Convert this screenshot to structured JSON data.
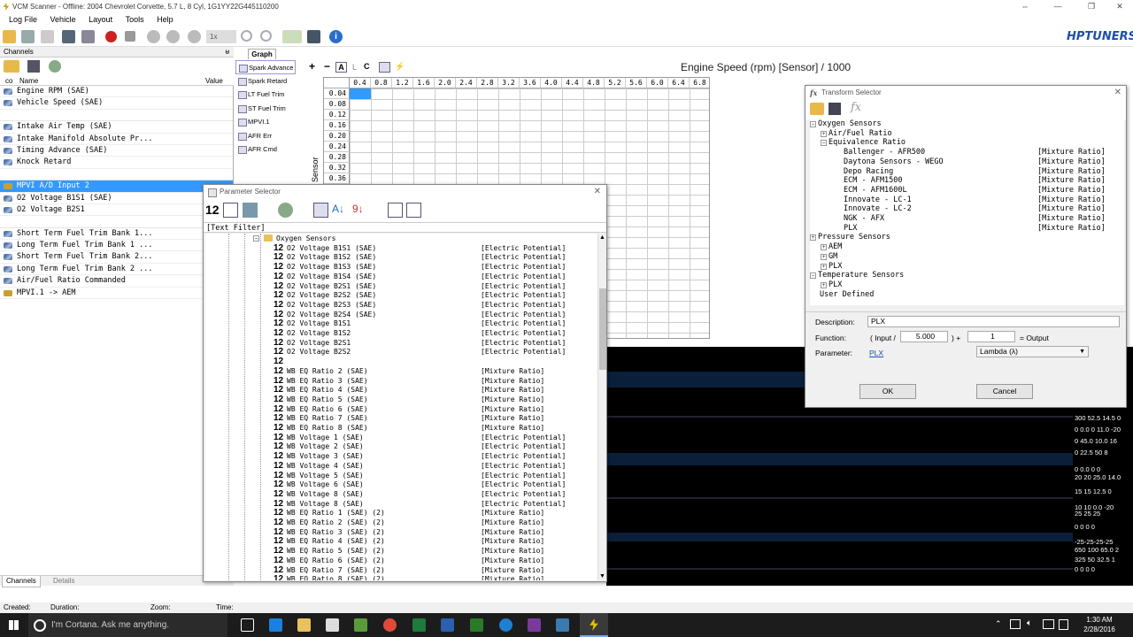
{
  "titlebar": {
    "title": "VCM Scanner - Offline: 2004 Chevrolet Corvette, 5.7 L, 8 Cyl, 1G1YY22G445110200"
  },
  "menu": [
    "Log File",
    "Vehicle",
    "Layout",
    "Tools",
    "Help"
  ],
  "toolbar": {
    "speed_value": "1x"
  },
  "logo": {
    "text": "HPTUNERS"
  },
  "channels": {
    "header": "Channels",
    "pin": "ᵾ",
    "col_co": "co",
    "col_name": "Name",
    "col_value": "Value",
    "rows": [
      {
        "name": "Engine RPM (SAE)",
        "icon": "gauge-icon"
      },
      {
        "name": "Vehicle Speed (SAE)",
        "icon": "gauge-icon"
      },
      {
        "name": "",
        "icon": ""
      },
      {
        "name": "Intake Air Temp (SAE)",
        "icon": "gauge-icon"
      },
      {
        "name": "Intake Manifold Absolute Pr...",
        "icon": "gauge-icon"
      },
      {
        "name": "Timing Advance (SAE)",
        "icon": "gauge-icon"
      },
      {
        "name": "Knock Retard",
        "icon": "gauge-icon"
      },
      {
        "name": "",
        "icon": ""
      },
      {
        "name": "MPVI A/D Input 2",
        "icon": "analog-icon"
      },
      {
        "name": "O2 Voltage B1S1 (SAE)",
        "icon": "gauge-icon"
      },
      {
        "name": "O2 Voltage B2S1",
        "icon": "gauge-icon"
      },
      {
        "name": "",
        "icon": ""
      },
      {
        "name": "Short Term Fuel Trim Bank 1...",
        "icon": "gauge-icon"
      },
      {
        "name": "Long Term Fuel Trim Bank 1 ...",
        "icon": "gauge-icon"
      },
      {
        "name": "Short Term Fuel Trim Bank 2...",
        "icon": "gauge-icon"
      },
      {
        "name": "Long Term Fuel Trim Bank 2 ...",
        "icon": "gauge-icon"
      },
      {
        "name": "Air/Fuel Ratio Commanded",
        "icon": "gauge-icon"
      },
      {
        "name": "MPVI.1 -> AEM",
        "icon": "analog-icon"
      }
    ],
    "tab_channels": "Channels",
    "tab_details": "Details"
  },
  "graph": {
    "tab": "Graph",
    "side_items": [
      "Spark Advance",
      "Spark Retard",
      "LT Fuel Trim",
      "ST Fuel Trim",
      "MPVI.1",
      "AFR Err",
      "AFR Cmd"
    ],
    "tool_labels": [
      "+",
      "−",
      "A",
      "L",
      "C"
    ],
    "title": "Engine Speed (rpm) [Sensor] / 1000",
    "y_axis_label": "Sensor",
    "col_headers": [
      "0.4",
      "0.8",
      "1.2",
      "1.6",
      "2.0",
      "2.4",
      "2.8",
      "3.2",
      "3.6",
      "4.0",
      "4.4",
      "4.8",
      "5.2",
      "5.6",
      "6.0",
      "6.4",
      "6.8"
    ],
    "row_headers": [
      "0.04",
      "0.08",
      "0.12",
      "0.16",
      "0.20",
      "0.24",
      "0.28",
      "0.32",
      "0.36"
    ]
  },
  "scope_values": [
    "300 52.5  14.5  0",
    "0  0.0   0  11.0 -20",
    "0 45.0  10.0 16",
    "0  22.5  50  8",
    "0  0.0  0  0",
    "20 20 25.0 14.0",
    "15  15  12.5 0",
    "10 10 0.0 -20",
    "25 25 25",
    "0  0  0  0",
    "-25-25-25-25",
    "650  100 65.0 2",
    "325  50  32.5 1",
    "0  0  0  0"
  ],
  "param_selector": {
    "title": "Parameter Selector",
    "filter": "[Text Filter]",
    "group": "Oxygen Sensors",
    "rows": [
      {
        "name": "O2 Voltage B1S1 (SAE)",
        "unit": "[Electric Potential]"
      },
      {
        "name": "O2 Voltage B1S2 (SAE)",
        "unit": "[Electric Potential]"
      },
      {
        "name": "O2 Voltage B1S3 (SAE)",
        "unit": "[Electric Potential]"
      },
      {
        "name": "O2 Voltage B1S4 (SAE)",
        "unit": "[Electric Potential]"
      },
      {
        "name": "O2 Voltage B2S1 (SAE)",
        "unit": "[Electric Potential]"
      },
      {
        "name": "O2 Voltage B2S2 (SAE)",
        "unit": "[Electric Potential]"
      },
      {
        "name": "O2 Voltage B2S3 (SAE)",
        "unit": "[Electric Potential]"
      },
      {
        "name": "O2 Voltage B2S4 (SAE)",
        "unit": "[Electric Potential]"
      },
      {
        "name": "O2 Voltage B1S1",
        "unit": "[Electric Potential]"
      },
      {
        "name": "O2 Voltage B1S2",
        "unit": "[Electric Potential]"
      },
      {
        "name": "O2 Voltage B2S1",
        "unit": "[Electric Potential]"
      },
      {
        "name": "O2 Voltage B2S2",
        "unit": "[Electric Potential]"
      },
      {
        "name": "",
        "unit": ""
      },
      {
        "name": "WB EQ Ratio 2 (SAE)",
        "unit": "[Mixture Ratio]"
      },
      {
        "name": "WB EQ Ratio 3 (SAE)",
        "unit": "[Mixture Ratio]"
      },
      {
        "name": "WB EQ Ratio 4 (SAE)",
        "unit": "[Mixture Ratio]"
      },
      {
        "name": "WB EQ Ratio 5 (SAE)",
        "unit": "[Mixture Ratio]"
      },
      {
        "name": "WB EQ Ratio 6 (SAE)",
        "unit": "[Mixture Ratio]"
      },
      {
        "name": "WB EQ Ratio 7 (SAE)",
        "unit": "[Mixture Ratio]"
      },
      {
        "name": "WB EQ Ratio 8 (SAE)",
        "unit": "[Mixture Ratio]"
      },
      {
        "name": "WB Voltage 1 (SAE)",
        "unit": "[Electric Potential]"
      },
      {
        "name": "WB Voltage 2 (SAE)",
        "unit": "[Electric Potential]"
      },
      {
        "name": "WB Voltage 3 (SAE)",
        "unit": "[Electric Potential]"
      },
      {
        "name": "WB Voltage 4 (SAE)",
        "unit": "[Electric Potential]"
      },
      {
        "name": "WB Voltage 5 (SAE)",
        "unit": "[Electric Potential]"
      },
      {
        "name": "WB Voltage 6 (SAE)",
        "unit": "[Electric Potential]"
      },
      {
        "name": "WB Voltage 8 (SAE)",
        "unit": "[Electric Potential]"
      },
      {
        "name": "WB Voltage 8 (SAE)",
        "unit": "[Electric Potential]"
      },
      {
        "name": "WB EQ Ratio 1 (SAE) (2)",
        "unit": "[Mixture Ratio]"
      },
      {
        "name": "WB EQ Ratio 2 (SAE) (2)",
        "unit": "[Mixture Ratio]"
      },
      {
        "name": "WB EQ Ratio 3 (SAE) (2)",
        "unit": "[Mixture Ratio]"
      },
      {
        "name": "WB EQ Ratio 4 (SAE) (2)",
        "unit": "[Mixture Ratio]"
      },
      {
        "name": "WB EQ Ratio 5 (SAE) (2)",
        "unit": "[Mixture Ratio]"
      },
      {
        "name": "WB EQ Ratio 6 (SAE) (2)",
        "unit": "[Mixture Ratio]"
      },
      {
        "name": "WB EQ Ratio 7 (SAE) (2)",
        "unit": "[Mixture Ratio]"
      },
      {
        "name": "WB EQ Ratio 8 (SAE) (2)",
        "unit": "[Mixture Ratio]"
      }
    ]
  },
  "transform_selector": {
    "title": "Transform Selector",
    "tree": [
      {
        "label": "Oxygen Sensors",
        "depth": 0,
        "exp": "−",
        "unit": ""
      },
      {
        "label": "Air/Fuel Ratio",
        "depth": 1,
        "exp": "+",
        "unit": ""
      },
      {
        "label": "Equivalence Ratio",
        "depth": 1,
        "exp": "−",
        "unit": ""
      },
      {
        "label": "Ballenger - AFR500",
        "depth": 2,
        "exp": "",
        "unit": "[Mixture Ratio]"
      },
      {
        "label": "Daytona Sensors - WEGO",
        "depth": 2,
        "exp": "",
        "unit": "[Mixture Ratio]"
      },
      {
        "label": "Depo Racing",
        "depth": 2,
        "exp": "",
        "unit": "[Mixture Ratio]"
      },
      {
        "label": "ECM - AFM1500",
        "depth": 2,
        "exp": "",
        "unit": "[Mixture Ratio]"
      },
      {
        "label": "ECM - AFM1600L",
        "depth": 2,
        "exp": "",
        "unit": "[Mixture Ratio]"
      },
      {
        "label": "Innovate - LC-1",
        "depth": 2,
        "exp": "",
        "unit": "[Mixture Ratio]"
      },
      {
        "label": "Innovate - LC-2",
        "depth": 2,
        "exp": "",
        "unit": "[Mixture Ratio]"
      },
      {
        "label": "NGK - AFX",
        "depth": 2,
        "exp": "",
        "unit": "[Mixture Ratio]"
      },
      {
        "label": "PLX",
        "depth": 2,
        "exp": "",
        "unit": "[Mixture Ratio]"
      },
      {
        "label": "Pressure Sensors",
        "depth": 0,
        "exp": "+",
        "unit": ""
      },
      {
        "label": "AEM",
        "depth": 1,
        "exp": "+",
        "unit": ""
      },
      {
        "label": "GM",
        "depth": 1,
        "exp": "+",
        "unit": ""
      },
      {
        "label": "PLX",
        "depth": 1,
        "exp": "+",
        "unit": ""
      },
      {
        "label": "Temperature Sensors",
        "depth": 0,
        "exp": "−",
        "unit": ""
      },
      {
        "label": "PLX",
        "depth": 1,
        "exp": "+",
        "unit": ""
      },
      {
        "label": "User Defined",
        "depth": 0,
        "exp": "",
        "unit": ""
      }
    ],
    "description_label": "Description:",
    "description_value": "PLX",
    "function_label": "Function:",
    "function_prefix": "( Input /",
    "function_divisor": "5.000",
    "function_mid": ") +",
    "function_offset": "1",
    "function_suffix": "= Output",
    "parameter_label": "Parameter:",
    "parameter_link": "PLX",
    "parameter_select": "Lambda (λ)",
    "ok_label": "OK",
    "cancel_label": "Cancel"
  },
  "statusbar": {
    "created": "Created:",
    "duration": "Duration:",
    "zoom": "Zoom:",
    "time": "Time:"
  },
  "taskbar": {
    "search_placeholder": "I'm Cortana. Ask me anything.",
    "time": "1:30 AM",
    "date": "2/28/2016"
  },
  "colors": {
    "selection": "#3399ff",
    "link": "#1f4fa8",
    "record": "#cc2222",
    "taskbar": "#1c1c1c",
    "scope_bg": "#000000"
  }
}
